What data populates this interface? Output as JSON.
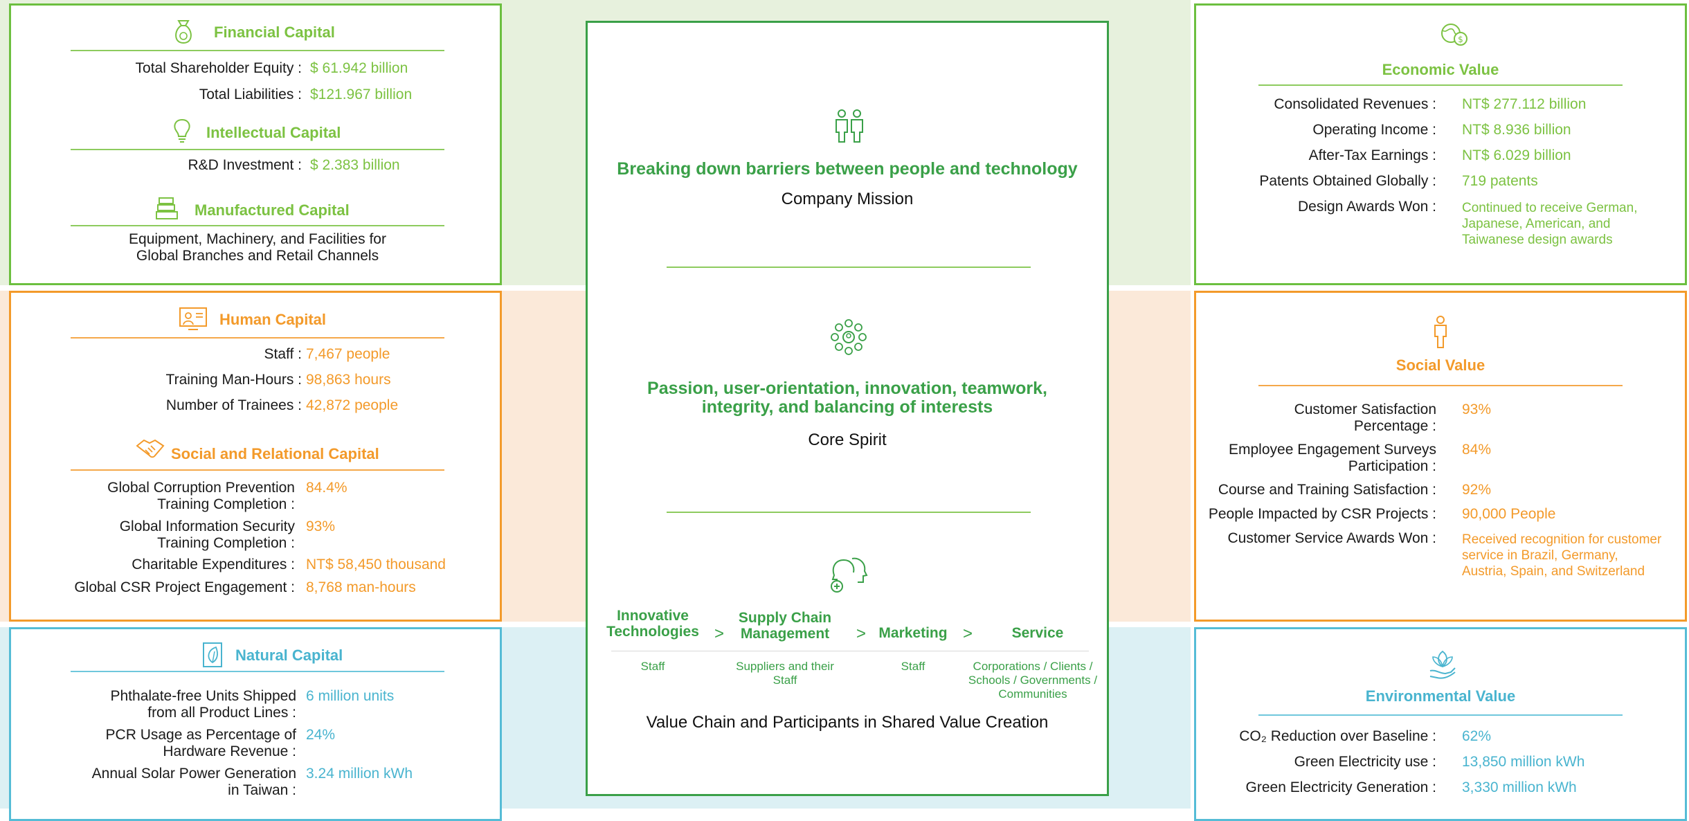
{
  "left": {
    "financial": {
      "title": "Financial Capital",
      "rows": [
        {
          "label": "Total Shareholder Equity :",
          "value": "$ 61.942 billion"
        },
        {
          "label": "Total Liabilities :",
          "value": "$121.967 billion"
        }
      ]
    },
    "intellectual": {
      "title": "Intellectual Capital",
      "rows": [
        {
          "label": "R&D Investment :",
          "value": "$ 2.383 billion"
        }
      ]
    },
    "manufactured": {
      "title": "Manufactured Capital",
      "text_line1": "Equipment, Machinery, and Facilities for",
      "text_line2": "Global Branches and Retail Channels"
    },
    "human": {
      "title": "Human Capital",
      "rows": [
        {
          "label": "Staff :",
          "value": "7,467 people"
        },
        {
          "label": "Training Man-Hours :",
          "value": "98,863 hours"
        },
        {
          "label": "Number of Trainees :",
          "value": "42,872 people"
        }
      ]
    },
    "social": {
      "title": "Social and Relational Capital",
      "rows": [
        {
          "label1": "Global Corruption Prevention",
          "label2": "Training Completion :",
          "value": "84.4%"
        },
        {
          "label1": "Global Information Security",
          "label2": "Training Completion :",
          "value": "93%"
        },
        {
          "label": "Charitable Expenditures :",
          "value": "NT$ 58,450 thousand"
        },
        {
          "label": "Global CSR Project Engagement :",
          "value": "8,768 man-hours"
        }
      ]
    },
    "natural": {
      "title": "Natural Capital",
      "rows": [
        {
          "label1": "Phthalate-free Units Shipped",
          "label2": "from all Product Lines :",
          "value": "6 million units"
        },
        {
          "label1": "PCR Usage as Percentage of",
          "label2": "Hardware Revenue :",
          "value": "24%"
        },
        {
          "label1": "Annual Solar Power Generation",
          "label2": "in Taiwan :",
          "value": "3.24 million kWh"
        }
      ]
    }
  },
  "center": {
    "mission": "Breaking down barriers between people and technology",
    "mission_caption": "Company Mission",
    "spirit_line1": "Passion, user-orientation, innovation, teamwork,",
    "spirit_line2": "integrity, and balancing of interests",
    "spirit_caption": "Core Spirit",
    "chain": [
      {
        "line1": "Innovative",
        "line2": "Technologies",
        "participants1": "Staff",
        "participants2": "",
        "participants3": ""
      },
      {
        "line1": "Supply Chain",
        "line2": "Management",
        "participants1": "Suppliers and their",
        "participants2": "Staff",
        "participants3": ""
      },
      {
        "line1": "Marketing",
        "line2": "",
        "participants1": "Staff",
        "participants2": "",
        "participants3": ""
      },
      {
        "line1": "Service",
        "line2": "",
        "participants1": "Corporations / Clients /",
        "participants2": "Schools / Governments /",
        "participants3": "Communities"
      }
    ],
    "separator": ">",
    "chain_caption": "Value Chain and Participants in Shared Value Creation"
  },
  "right": {
    "economic": {
      "title": "Economic Value",
      "rows": [
        {
          "label": "Consolidated Revenues :",
          "value": "NT$ 277.112 billion"
        },
        {
          "label": "Operating Income :",
          "value": "NT$ 8.936 billion"
        },
        {
          "label": "After-Tax Earnings :",
          "value": "NT$ 6.029 billion"
        },
        {
          "label": "Patents Obtained Globally :",
          "value": "719 patents"
        },
        {
          "label": "Design Awards Won :",
          "value1": "Continued to receive German,",
          "value2": "Japanese, American, and",
          "value3": "Taiwanese design awards"
        }
      ]
    },
    "social": {
      "title": "Social Value",
      "rows": [
        {
          "label1": "Customer Satisfaction",
          "label2": "Percentage :",
          "value": "93%"
        },
        {
          "label1": "Employee Engagement Surveys",
          "label2": "Participation :",
          "value": "84%"
        },
        {
          "label": "Course and Training Satisfaction :",
          "value": "92%"
        },
        {
          "label": "People Impacted by CSR Projects :",
          "value": "90,000 People"
        },
        {
          "label": "Customer Service Awards Won :",
          "value1": "Received recognition for customer",
          "value2": "service in Brazil, Germany,",
          "value3": "Austria, Spain, and Switzerland"
        }
      ]
    },
    "environmental": {
      "title": "Environmental Value",
      "rows": [
        {
          "label": "CO₂ Reduction over Baseline :",
          "value": "62%"
        },
        {
          "label": "Green Electricity use :",
          "value": "13,850 million kWh"
        },
        {
          "label": "Green Electricity Generation :",
          "value": "3,330 million kWh"
        }
      ]
    }
  },
  "colors": {
    "green": "#7cc242",
    "dark_green": "#3aa048",
    "orange": "#f39a2a",
    "blue": "#49b4cf"
  }
}
